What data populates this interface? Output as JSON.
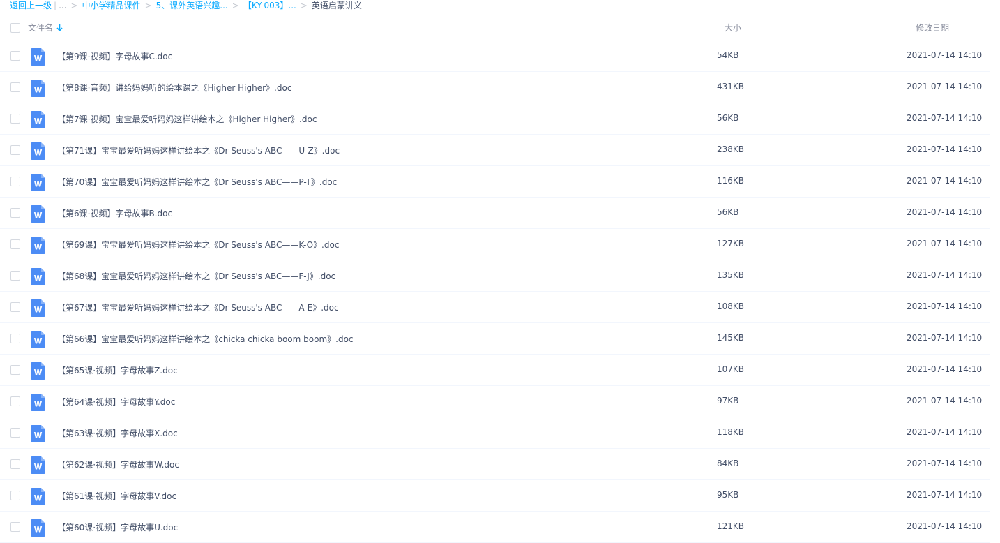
{
  "breadcrumb": {
    "back": "返回上一级",
    "ellipsis": "...",
    "crumbs": [
      "中小学精品课件",
      "5、课外英语兴趣...",
      "【KY-003】..."
    ],
    "current": "英语启蒙讲义"
  },
  "header": {
    "name": "文件名",
    "size": "大小",
    "date": "修改日期"
  },
  "icon": {
    "letter": "W",
    "color": "#4c8cf5"
  },
  "files": [
    {
      "name": "【第9课·视频】字母故事C.doc",
      "size": "54KB",
      "date": "2021-07-14 14:10"
    },
    {
      "name": "【第8课·音频】讲给妈妈听的绘本课之《Higher Higher》.doc",
      "size": "431KB",
      "date": "2021-07-14 14:10"
    },
    {
      "name": "【第7课·视频】宝宝最爱听妈妈这样讲绘本之《Higher Higher》.doc",
      "size": "56KB",
      "date": "2021-07-14 14:10"
    },
    {
      "name": "【第71课】宝宝最爱听妈妈这样讲绘本之《Dr Seuss's ABC——U-Z》.doc",
      "size": "238KB",
      "date": "2021-07-14 14:10"
    },
    {
      "name": "【第70课】宝宝最爱听妈妈这样讲绘本之《Dr Seuss's ABC——P-T》.doc",
      "size": "116KB",
      "date": "2021-07-14 14:10"
    },
    {
      "name": "【第6课·视频】字母故事B.doc",
      "size": "56KB",
      "date": "2021-07-14 14:10"
    },
    {
      "name": "【第69课】宝宝最爱听妈妈这样讲绘本之《Dr Seuss's ABC——K-O》.doc",
      "size": "127KB",
      "date": "2021-07-14 14:10"
    },
    {
      "name": "【第68课】宝宝最爱听妈妈这样讲绘本之《Dr Seuss's ABC——F-J》.doc",
      "size": "135KB",
      "date": "2021-07-14 14:10"
    },
    {
      "name": "【第67课】宝宝最爱听妈妈这样讲绘本之《Dr Seuss's ABC——A-E》.doc",
      "size": "108KB",
      "date": "2021-07-14 14:10"
    },
    {
      "name": "【第66课】宝宝最爱听妈妈这样讲绘本之《chicka chicka boom boom》.doc",
      "size": "145KB",
      "date": "2021-07-14 14:10"
    },
    {
      "name": "【第65课·视频】字母故事Z.doc",
      "size": "107KB",
      "date": "2021-07-14 14:10"
    },
    {
      "name": "【第64课·视频】字母故事Y.doc",
      "size": "97KB",
      "date": "2021-07-14 14:10"
    },
    {
      "name": "【第63课·视频】字母故事X.doc",
      "size": "118KB",
      "date": "2021-07-14 14:10"
    },
    {
      "name": "【第62课·视频】字母故事W.doc",
      "size": "84KB",
      "date": "2021-07-14 14:10"
    },
    {
      "name": "【第61课·视频】字母故事V.doc",
      "size": "95KB",
      "date": "2021-07-14 14:10"
    },
    {
      "name": "【第60课·视频】字母故事U.doc",
      "size": "121KB",
      "date": "2021-07-14 14:10"
    }
  ]
}
